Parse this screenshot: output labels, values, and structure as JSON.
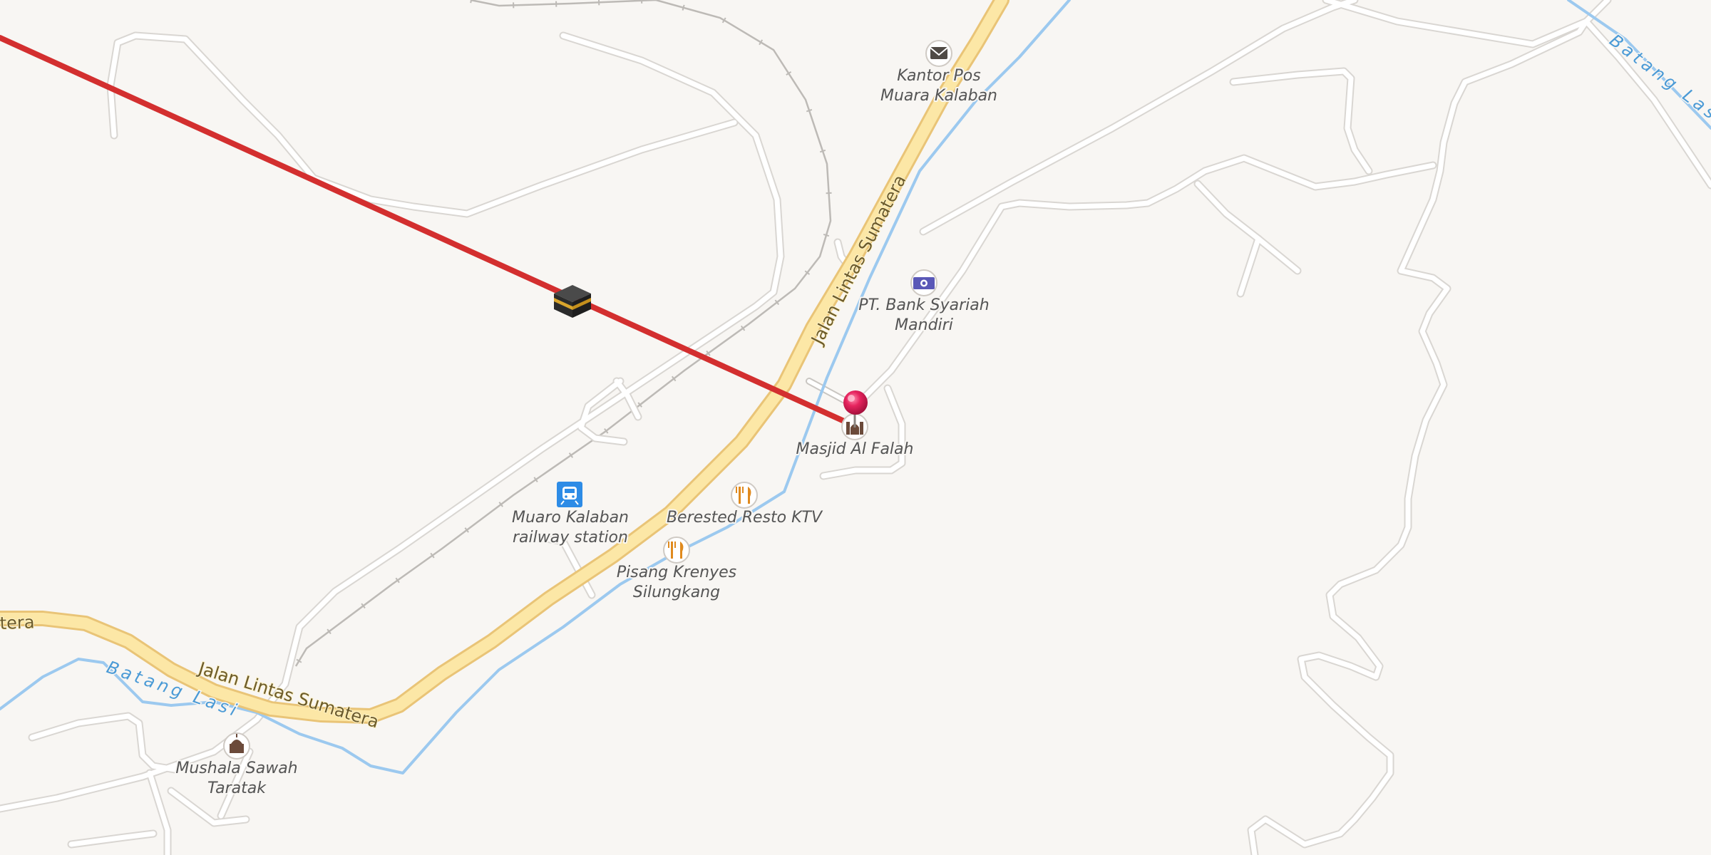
{
  "map": {
    "colors": {
      "background": "#f8f6f3",
      "minor_road": "#ffffff",
      "minor_road_casing": "#d9d6d2",
      "main_road": "#fce7a6",
      "main_road_casing": "#e9c477",
      "river": "#9cc9ef",
      "railway": "#bdbab6",
      "route_line": "#d32f2f",
      "pin": "#e6245e"
    },
    "roads": {
      "main_left_label": "Jalan Lintas Sumatera",
      "main_upper_label": "Jalan Lintas Sumatera",
      "main_clipped_label": "tera"
    },
    "rivers": {
      "lower_label": "Batang Lasi",
      "upper_right_label": "Batang Las"
    },
    "pois": [
      {
        "key": "post",
        "icon": "envelope-icon",
        "line1": "Kantor Pos",
        "line2": "Muara Kalaban"
      },
      {
        "key": "bank",
        "icon": "banknote-icon",
        "line1": "PT. Bank Syariah",
        "line2": "Mandiri"
      },
      {
        "key": "mosque",
        "icon": "mosque-icon",
        "line1": "Masjid Al Falah",
        "line2": ""
      },
      {
        "key": "station",
        "icon": "train-icon",
        "line1": "Muaro Kalaban",
        "line2": "railway station"
      },
      {
        "key": "resto",
        "icon": "fork-knife-icon",
        "line1": "Berested Resto KTV",
        "line2": ""
      },
      {
        "key": "pisang",
        "icon": "fork-knife-icon",
        "line1": "Pisang Krenyes",
        "line2": "Silungkang"
      },
      {
        "key": "mushala",
        "icon": "mosque-icon",
        "line1": "Mushala Sawah",
        "line2": "Taratak"
      }
    ],
    "markers": {
      "kaaba": "kaaba-icon",
      "pin": "location-pin-icon"
    }
  }
}
